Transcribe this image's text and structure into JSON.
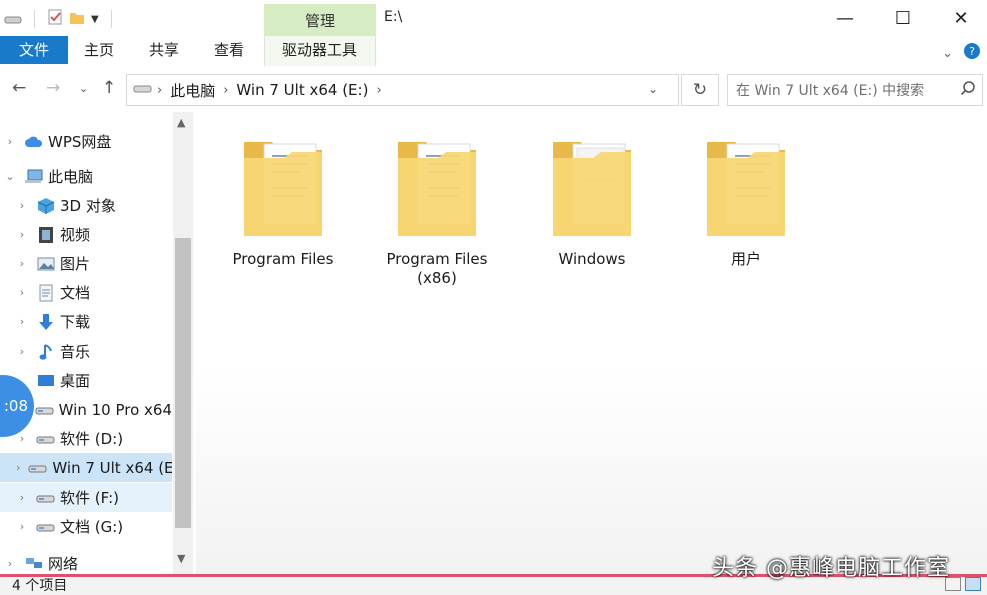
{
  "window": {
    "title": "E:\\",
    "context_tab": "管理",
    "controls": {
      "minimize": "—",
      "maximize": "☐",
      "close": "✕"
    }
  },
  "ribbon": {
    "tabs": [
      {
        "label": "文件",
        "active": true
      },
      {
        "label": "主页"
      },
      {
        "label": "共享"
      },
      {
        "label": "查看"
      },
      {
        "label": "驱动器工具"
      }
    ],
    "collapse_icon": "chevron-down-icon",
    "help_icon": "help-icon"
  },
  "address_bar": {
    "breadcrumbs": [
      "此电脑",
      "Win 7 Ult x64 (E:)"
    ],
    "search_placeholder": "在 Win 7 Ult x64 (E:) 中搜索"
  },
  "nav_pane": {
    "items": [
      {
        "label": "WPS网盘",
        "icon": "cloud-icon",
        "level": 0,
        "chev": "›"
      },
      {
        "label": "此电脑",
        "icon": "computer-icon",
        "level": 0,
        "chev": "⌄"
      },
      {
        "label": "3D 对象",
        "icon": "cube-3d-icon",
        "level": 1,
        "chev": "›"
      },
      {
        "label": "视频",
        "icon": "video-icon",
        "level": 1,
        "chev": "›"
      },
      {
        "label": "图片",
        "icon": "picture-icon",
        "level": 1,
        "chev": "›"
      },
      {
        "label": "文档",
        "icon": "document-icon",
        "level": 1,
        "chev": "›"
      },
      {
        "label": "下载",
        "icon": "download-icon",
        "level": 1,
        "chev": "›"
      },
      {
        "label": "音乐",
        "icon": "music-icon",
        "level": 1,
        "chev": "›"
      },
      {
        "label": "桌面",
        "icon": "desktop-icon",
        "level": 1,
        "chev": ""
      },
      {
        "label": "Win 10 Pro x64",
        "icon": "drive-icon",
        "level": 1,
        "chev": ""
      },
      {
        "label": "软件 (D:)",
        "icon": "drive-icon",
        "level": 1,
        "chev": "›"
      },
      {
        "label": "Win 7 Ult x64 (E",
        "icon": "drive-icon",
        "level": 1,
        "chev": "›",
        "selected": true
      },
      {
        "label": "软件 (F:)",
        "icon": "drive-icon",
        "level": 1,
        "chev": "›",
        "hover": true
      },
      {
        "label": "文档 (G:)",
        "icon": "drive-icon",
        "level": 1,
        "chev": "›"
      },
      {
        "label": "网络",
        "icon": "network-icon",
        "level": 0,
        "chev": "›"
      }
    ]
  },
  "content": {
    "folders": [
      {
        "name": "Program Files",
        "icon": "folder-icon"
      },
      {
        "name": "Program Files\n(x86)",
        "icon": "folder-icon"
      },
      {
        "name": "Windows",
        "icon": "folder-icon"
      },
      {
        "name": "用户",
        "icon": "folder-icon"
      }
    ]
  },
  "status_bar": {
    "item_count": "4 个项目"
  },
  "overlay": {
    "timer": ":08",
    "watermark": "头条 @惠峰电脑工作室"
  }
}
